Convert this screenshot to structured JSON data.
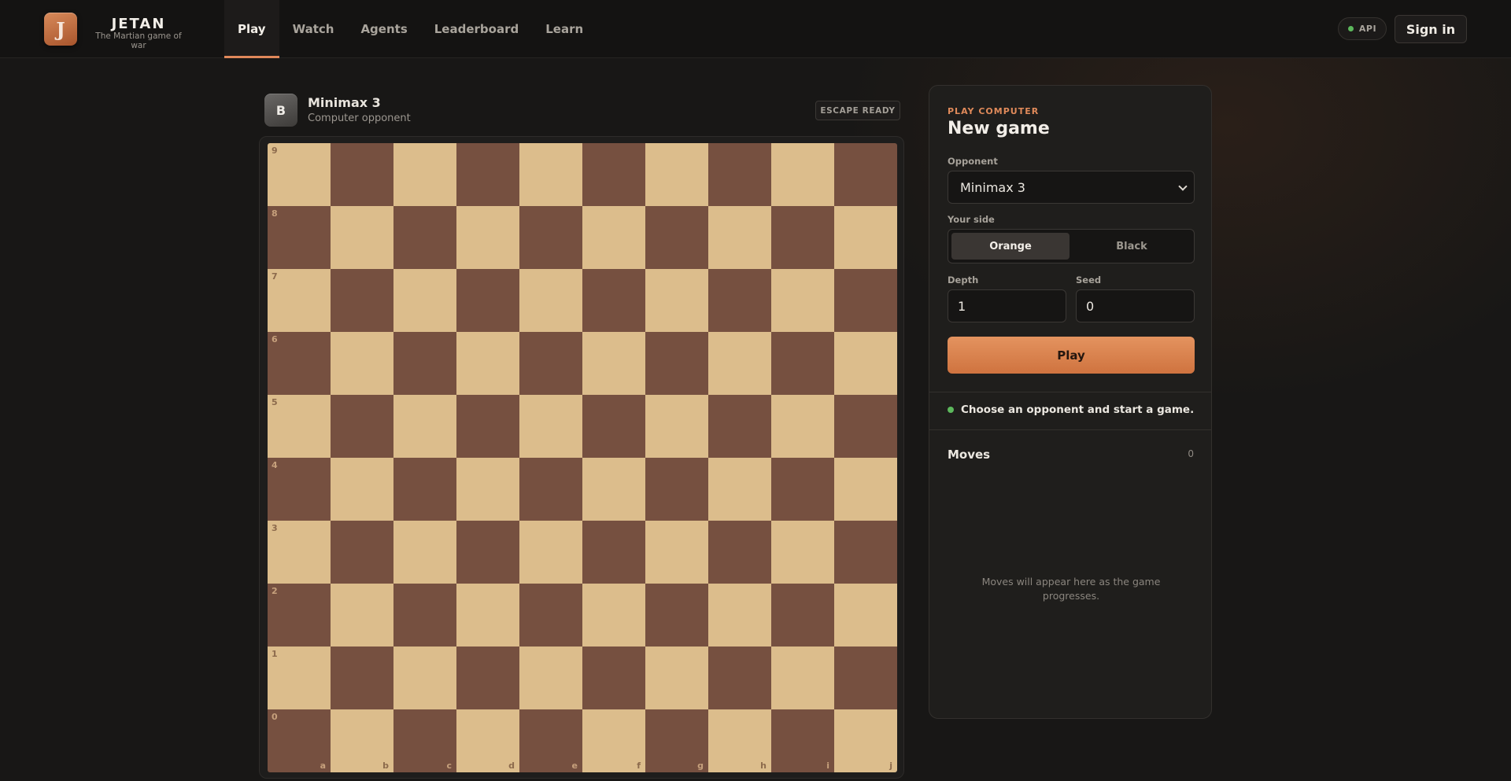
{
  "header": {
    "logo_letter": "J",
    "brand": "JETAN",
    "tagline": "The Martian game of war",
    "nav": [
      {
        "label": "Play",
        "active": true
      },
      {
        "label": "Watch",
        "active": false
      },
      {
        "label": "Agents",
        "active": false
      },
      {
        "label": "Leaderboard",
        "active": false
      },
      {
        "label": "Learn",
        "active": false
      }
    ],
    "api_label": "API",
    "sign_in_label": "Sign in"
  },
  "opponent": {
    "avatar_letter": "B",
    "name": "Minimax 3",
    "role": "Computer opponent",
    "badge": "ESCAPE READY"
  },
  "board": {
    "files": [
      "a",
      "b",
      "c",
      "d",
      "e",
      "f",
      "g",
      "h",
      "i",
      "j"
    ],
    "ranks": [
      "9",
      "8",
      "7",
      "6",
      "5",
      "4",
      "3",
      "2",
      "1",
      "0"
    ],
    "light_color": "#dcbd8c",
    "dark_color": "#765040"
  },
  "panel": {
    "eyebrow": "PLAY COMPUTER",
    "title": "New game",
    "opponent_label": "Opponent",
    "opponent_value": "Minimax 3",
    "side_label": "Your side",
    "side_options": [
      "Orange",
      "Black"
    ],
    "side_selected": "Orange",
    "depth_label": "Depth",
    "depth_value": "1",
    "seed_label": "Seed",
    "seed_value": "0",
    "play_label": "Play",
    "status": "Choose an opponent and start a game.",
    "moves_title": "Moves",
    "moves_count": "0",
    "moves_empty": "Moves will appear here as the game progresses."
  },
  "colors": {
    "accent": "#e0885a",
    "status_ok": "#5cb85c"
  }
}
